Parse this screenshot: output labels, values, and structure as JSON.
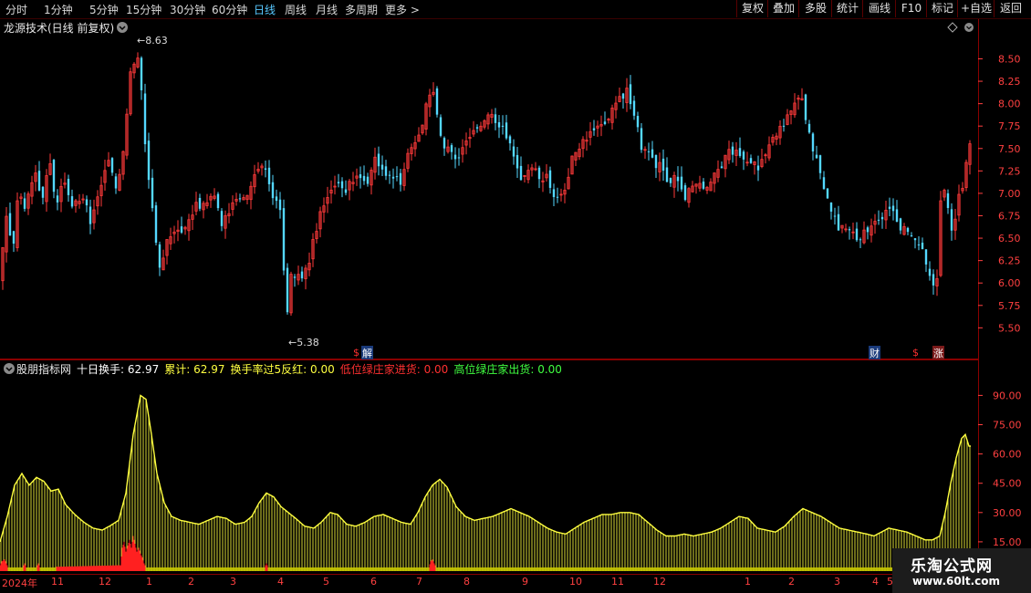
{
  "toolbar": {
    "periods": [
      "分时",
      "1分钟",
      "5分钟",
      "15分钟",
      "30分钟",
      "60分钟",
      "日线",
      "周线",
      "月线",
      "多周期",
      "更多 >"
    ],
    "active_period": "日线",
    "buttons": [
      "复权",
      "叠加",
      "多股",
      "统计",
      "画线",
      "F10",
      "标记",
      "+自选",
      "返回"
    ]
  },
  "main_panel": {
    "title": "龙源技术(日线 前复权)",
    "high_label": "8.63",
    "low_label": "5.38",
    "markers": [
      "解",
      "财",
      "涨"
    ],
    "dollar_glyph": "$"
  },
  "indicator_panel": {
    "name": "股朋指标网",
    "values": [
      {
        "label": "十日换手:",
        "value": "62.97",
        "color": "#ffffff"
      },
      {
        "label": "累计:",
        "value": "62.97",
        "color": "#ffff40"
      },
      {
        "label": "换手率过5反红:",
        "value": "0.00",
        "color": "#ffff40"
      },
      {
        "label": "低位绿庄家进货:",
        "value": "0.00",
        "color": "#ff3030"
      },
      {
        "label": "高位绿庄家出货:",
        "value": "0.00",
        "color": "#40ff40"
      }
    ]
  },
  "x_axis": {
    "labels": [
      "2024年",
      "11",
      "12",
      "1",
      "2",
      "3",
      "4",
      "5",
      "6",
      "7",
      "8",
      "9",
      "10",
      "11",
      "12",
      "1",
      "2",
      "3",
      "4",
      "5"
    ]
  },
  "watermark": {
    "line1": "乐淘公式网",
    "line2": "www.60lt.com"
  },
  "colors": {
    "up": "#ff3a3a",
    "down": "#54d8ff",
    "accent": "#58c8ff",
    "axis": "#ff4040",
    "frame": "#8a0000",
    "indicator": "#ffff40"
  },
  "chart_data": [
    {
      "type": "candlestick",
      "title": "龙源技术(日线 前复权)",
      "ylim": [
        5.3,
        8.8
      ],
      "yticks": [
        5.5,
        5.75,
        6.0,
        6.25,
        6.5,
        6.75,
        7.0,
        7.25,
        7.5,
        7.75,
        8.0,
        8.25,
        8.5
      ],
      "ytick_labels": [
        "5.50",
        "5.75",
        "6.00",
        "6.25",
        "6.50",
        "6.75",
        "7.00",
        "7.25",
        "7.50",
        "7.75",
        "8.00",
        "8.25",
        "8.50"
      ],
      "annotations": [
        {
          "text": "8.63",
          "value": 8.63
        },
        {
          "text": "5.38",
          "value": 5.38
        }
      ],
      "close_path": [
        [
          0,
          6.0
        ],
        [
          6,
          6.8
        ],
        [
          14,
          6.35
        ],
        [
          20,
          7.0
        ],
        [
          28,
          6.85
        ],
        [
          38,
          7.3
        ],
        [
          46,
          6.95
        ],
        [
          54,
          7.35
        ],
        [
          62,
          6.8
        ],
        [
          70,
          7.15
        ],
        [
          80,
          6.85
        ],
        [
          90,
          7.0
        ],
        [
          100,
          6.65
        ],
        [
          110,
          7.05
        ],
        [
          120,
          7.35
        ],
        [
          128,
          7.0
        ],
        [
          136,
          7.6
        ],
        [
          143,
          8.3
        ],
        [
          150,
          8.55
        ],
        [
          156,
          8.0
        ],
        [
          162,
          7.2
        ],
        [
          168,
          6.7
        ],
        [
          176,
          6.15
        ],
        [
          184,
          6.5
        ],
        [
          194,
          6.55
        ],
        [
          204,
          6.6
        ],
        [
          214,
          6.9
        ],
        [
          224,
          6.85
        ],
        [
          234,
          7.0
        ],
        [
          244,
          6.65
        ],
        [
          254,
          6.9
        ],
        [
          264,
          6.95
        ],
        [
          274,
          7.05
        ],
        [
          284,
          7.35
        ],
        [
          292,
          7.2
        ],
        [
          300,
          6.95
        ],
        [
          308,
          6.85
        ],
        [
          314,
          5.52
        ],
        [
          320,
          6.15
        ],
        [
          330,
          6.0
        ],
        [
          340,
          6.3
        ],
        [
          350,
          6.75
        ],
        [
          360,
          7.0
        ],
        [
          370,
          7.1
        ],
        [
          380,
          7.05
        ],
        [
          392,
          7.25
        ],
        [
          402,
          7.1
        ],
        [
          412,
          7.4
        ],
        [
          420,
          7.25
        ],
        [
          430,
          7.2
        ],
        [
          440,
          7.05
        ],
        [
          448,
          7.5
        ],
        [
          458,
          7.65
        ],
        [
          466,
          7.9
        ],
        [
          474,
          8.2
        ],
        [
          482,
          7.6
        ],
        [
          492,
          7.5
        ],
        [
          502,
          7.4
        ],
        [
          512,
          7.6
        ],
        [
          522,
          7.7
        ],
        [
          532,
          7.8
        ],
        [
          542,
          7.85
        ],
        [
          552,
          7.7
        ],
        [
          560,
          7.5
        ],
        [
          570,
          7.1
        ],
        [
          580,
          7.25
        ],
        [
          590,
          7.2
        ],
        [
          600,
          7.15
        ],
        [
          610,
          6.95
        ],
        [
          620,
          7.1
        ],
        [
          630,
          7.5
        ],
        [
          640,
          7.55
        ],
        [
          650,
          7.7
        ],
        [
          660,
          7.75
        ],
        [
          670,
          7.9
        ],
        [
          678,
          8.05
        ],
        [
          686,
          8.15
        ],
        [
          694,
          7.95
        ],
        [
          702,
          7.55
        ],
        [
          712,
          7.4
        ],
        [
          722,
          7.3
        ],
        [
          732,
          7.15
        ],
        [
          742,
          7.2
        ],
        [
          750,
          6.95
        ],
        [
          760,
          7.1
        ],
        [
          770,
          7.05
        ],
        [
          780,
          7.2
        ],
        [
          790,
          7.3
        ],
        [
          800,
          7.5
        ],
        [
          810,
          7.45
        ],
        [
          820,
          7.35
        ],
        [
          830,
          7.3
        ],
        [
          840,
          7.45
        ],
        [
          850,
          7.65
        ],
        [
          860,
          7.8
        ],
        [
          870,
          7.95
        ],
        [
          878,
          8.05
        ],
        [
          886,
          7.7
        ],
        [
          896,
          7.35
        ],
        [
          904,
          7.05
        ],
        [
          912,
          6.8
        ],
        [
          920,
          6.6
        ],
        [
          930,
          6.6
        ],
        [
          940,
          6.5
        ],
        [
          950,
          6.55
        ],
        [
          960,
          6.65
        ],
        [
          970,
          6.8
        ],
        [
          980,
          6.75
        ],
        [
          990,
          6.6
        ],
        [
          1000,
          6.5
        ],
        [
          1010,
          6.45
        ],
        [
          1018,
          6.15
        ],
        [
          1026,
          5.85
        ],
        [
          1032,
          7.2
        ],
        [
          1038,
          6.9
        ],
        [
          1044,
          6.55
        ],
        [
          1050,
          6.9
        ],
        [
          1056,
          7.1
        ],
        [
          1062,
          7.55
        ]
      ]
    },
    {
      "type": "bar",
      "title": "股朋指标网",
      "ylim": [
        0,
        100
      ],
      "yticks": [
        15,
        30,
        45,
        60,
        75,
        90
      ],
      "ytick_labels": [
        "15.00",
        "30.00",
        "45.00",
        "60.00",
        "75.00",
        "90.00"
      ],
      "series": [
        {
          "name": "十日换手",
          "color": "#ffff40",
          "path": [
            [
              0,
              15
            ],
            [
              8,
              28
            ],
            [
              16,
              44
            ],
            [
              24,
              50
            ],
            [
              32,
              44
            ],
            [
              40,
              48
            ],
            [
              48,
              46
            ],
            [
              56,
              41
            ],
            [
              64,
              42
            ],
            [
              72,
              34
            ],
            [
              82,
              29
            ],
            [
              92,
              25
            ],
            [
              102,
              22
            ],
            [
              112,
              21
            ],
            [
              120,
              23
            ],
            [
              130,
              26
            ],
            [
              138,
              40
            ],
            [
              146,
              70
            ],
            [
              154,
              90
            ],
            [
              160,
              88
            ],
            [
              166,
              70
            ],
            [
              172,
              50
            ],
            [
              180,
              35
            ],
            [
              188,
              28
            ],
            [
              198,
              26
            ],
            [
              208,
              25
            ],
            [
              218,
              24
            ],
            [
              228,
              26
            ],
            [
              238,
              28
            ],
            [
              248,
              27
            ],
            [
              258,
              24
            ],
            [
              268,
              25
            ],
            [
              276,
              28
            ],
            [
              284,
              35
            ],
            [
              292,
              40
            ],
            [
              300,
              38
            ],
            [
              308,
              33
            ],
            [
              316,
              30
            ],
            [
              324,
              27
            ],
            [
              334,
              23
            ],
            [
              344,
              22
            ],
            [
              352,
              25
            ],
            [
              362,
              30
            ],
            [
              370,
              29
            ],
            [
              380,
              24
            ],
            [
              390,
              23
            ],
            [
              400,
              25
            ],
            [
              410,
              28
            ],
            [
              420,
              29
            ],
            [
              430,
              27
            ],
            [
              440,
              25
            ],
            [
              450,
              24
            ],
            [
              458,
              30
            ],
            [
              466,
              38
            ],
            [
              474,
              44
            ],
            [
              482,
              47
            ],
            [
              490,
              43
            ],
            [
              500,
              33
            ],
            [
              510,
              28
            ],
            [
              520,
              26
            ],
            [
              530,
              27
            ],
            [
              540,
              28
            ],
            [
              550,
              30
            ],
            [
              560,
              32
            ],
            [
              570,
              30
            ],
            [
              580,
              28
            ],
            [
              590,
              25
            ],
            [
              600,
              22
            ],
            [
              610,
              20
            ],
            [
              620,
              19
            ],
            [
              630,
              22
            ],
            [
              640,
              25
            ],
            [
              650,
              27
            ],
            [
              660,
              29
            ],
            [
              670,
              29
            ],
            [
              680,
              30
            ],
            [
              690,
              30
            ],
            [
              700,
              29
            ],
            [
              710,
              25
            ],
            [
              720,
              21
            ],
            [
              730,
              18
            ],
            [
              740,
              18
            ],
            [
              750,
              19
            ],
            [
              760,
              18
            ],
            [
              770,
              19
            ],
            [
              780,
              20
            ],
            [
              790,
              22
            ],
            [
              800,
              25
            ],
            [
              810,
              28
            ],
            [
              820,
              27
            ],
            [
              830,
              22
            ],
            [
              840,
              21
            ],
            [
              850,
              20
            ],
            [
              860,
              23
            ],
            [
              870,
              28
            ],
            [
              880,
              32
            ],
            [
              890,
              30
            ],
            [
              900,
              28
            ],
            [
              910,
              25
            ],
            [
              920,
              22
            ],
            [
              930,
              21
            ],
            [
              940,
              20
            ],
            [
              950,
              19
            ],
            [
              958,
              18
            ],
            [
              966,
              20
            ],
            [
              974,
              22
            ],
            [
              984,
              21
            ],
            [
              994,
              20
            ],
            [
              1004,
              18
            ],
            [
              1014,
              16
            ],
            [
              1022,
              16
            ],
            [
              1030,
              18
            ],
            [
              1036,
              30
            ],
            [
              1042,
              45
            ],
            [
              1048,
              58
            ],
            [
              1054,
              68
            ],
            [
              1058,
              70
            ],
            [
              1062,
              64
            ]
          ]
        },
        {
          "name": "换手率过5反红",
          "color": "#ff2020",
          "path": [
            [
              0,
              3
            ],
            [
              2,
              5
            ],
            [
              5,
              6
            ],
            [
              7,
              4
            ],
            [
              9,
              2
            ],
            [
              25,
              2
            ],
            [
              27,
              4
            ],
            [
              29,
              2
            ],
            [
              40,
              2
            ],
            [
              42,
              4
            ],
            [
              44,
              2
            ],
            [
              132,
              3
            ],
            [
              134,
              12
            ],
            [
              136,
              15
            ],
            [
              138,
              10
            ],
            [
              140,
              13
            ],
            [
              142,
              16
            ],
            [
              144,
              12
            ],
            [
              146,
              18
            ],
            [
              148,
              14
            ],
            [
              150,
              10
            ],
            [
              152,
              12
            ],
            [
              154,
              9
            ],
            [
              156,
              7
            ],
            [
              158,
              4
            ],
            [
              160,
              2
            ],
            [
              290,
              2
            ],
            [
              292,
              4
            ],
            [
              294,
              2
            ],
            [
              470,
              2
            ],
            [
              472,
              5
            ],
            [
              474,
              6
            ],
            [
              476,
              4
            ],
            [
              478,
              2
            ]
          ]
        }
      ]
    }
  ]
}
